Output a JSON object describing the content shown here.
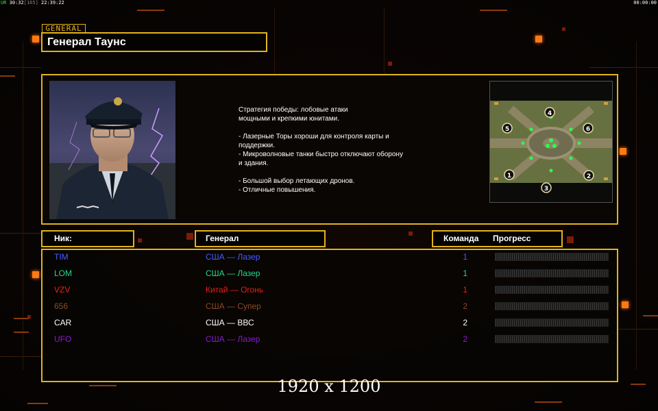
{
  "topbar": {
    "left_green": "UR",
    "left_time": "30:32",
    "left_fps": "[165]",
    "left_clock": "22:39:22",
    "right_timer": "00:00:00"
  },
  "general": {
    "tag": "GENERAL",
    "name": "Генерал Таунс"
  },
  "description": "Стратегия победы: лобовые атаки\nмощными и крепкими юнитами.\n\n- Лазерные Торы хороши для контроля карты и\n поддержки.\n- Микроволновые танки быстро отключают оборону\n и здания.\n\n- Большой выбор летающих дронов.\n- Отличные повышения.",
  "map": {
    "start_positions": [
      "1",
      "2",
      "3",
      "4",
      "5",
      "6"
    ]
  },
  "headers": {
    "nick": "Ник:",
    "general": "Генерал",
    "team": "Команда",
    "progress": "Прогресс"
  },
  "players": [
    {
      "nick": "TIM",
      "general": "США — Лазер",
      "team": "1",
      "color": "#4a5cff"
    },
    {
      "nick": "LOM",
      "general": "США — Лазер",
      "team": "1",
      "color": "#22d98a"
    },
    {
      "nick": "VZV",
      "general": "Китай — Огонь",
      "team": "1",
      "color": "#e8201a"
    },
    {
      "nick": "656",
      "general": "США — Супер",
      "team": "2",
      "color": "#8a4a2a"
    },
    {
      "nick": "CAR",
      "general": "США — ВВС",
      "team": "2",
      "color": "#ffffff"
    },
    {
      "nick": "UFO",
      "general": "США — Лазер",
      "team": "2",
      "color": "#8a1ad0"
    }
  ],
  "resolution": "1920 x 1200",
  "colors": {
    "accent": "#e3b31d",
    "bg": "#080403",
    "glow": "#ff7a12"
  }
}
